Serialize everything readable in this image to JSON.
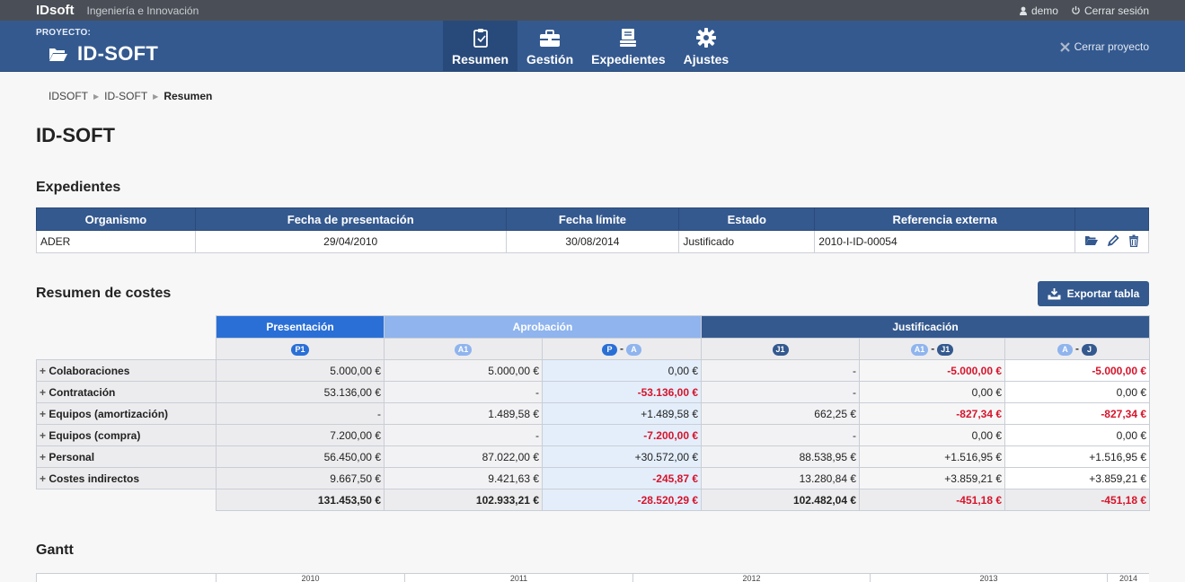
{
  "topbar": {
    "brand": "IDsoft",
    "tagline": "Ingeniería e Innovación",
    "user": "demo",
    "logout": "Cerrar sesión"
  },
  "header": {
    "project_label": "PROYECTO:",
    "project_name": "ID-SOFT",
    "close_project": "Cerrar proyecto",
    "nav": [
      {
        "label": "Resumen",
        "icon": "clipboard-icon",
        "active": true
      },
      {
        "label": "Gestión",
        "icon": "briefcase-icon",
        "active": false
      },
      {
        "label": "Expedientes",
        "icon": "file-stack-icon",
        "active": false
      },
      {
        "label": "Ajustes",
        "icon": "gear-icon",
        "active": false
      }
    ]
  },
  "breadcrumb": [
    "IDSOFT",
    "ID-SOFT",
    "Resumen"
  ],
  "page_title": "ID-SOFT",
  "expedientes": {
    "heading": "Expedientes",
    "columns": [
      "Organismo",
      "Fecha de presentación",
      "Fecha límite",
      "Estado",
      "Referencia externa"
    ],
    "rows": [
      {
        "organismo": "ADER",
        "fecha_presentacion": "29/04/2010",
        "fecha_limite": "30/08/2014",
        "estado": "Justificado",
        "referencia": "2010-I-ID-00054"
      }
    ]
  },
  "costes": {
    "heading": "Resumen de costes",
    "export_label": "Exportar tabla",
    "groups": [
      "Presentación",
      "Aprobación",
      "Justificación"
    ],
    "badges": {
      "p1": "P1",
      "a1": "A1",
      "p": "P",
      "a": "A",
      "j1": "J1",
      "j": "J",
      "dash": "-"
    },
    "rows": [
      {
        "name": "Colaboraciones",
        "p1": "5.000,00 €",
        "a1": "5.000,00 €",
        "pa": "0,00 €",
        "j1": "-",
        "a1j1": "-5.000,00 €",
        "aj": "-5.000,00 €"
      },
      {
        "name": "Contratación",
        "p1": "53.136,00 €",
        "a1": "-",
        "pa": "-53.136,00 €",
        "j1": "-",
        "a1j1": "0,00 €",
        "aj": "0,00 €"
      },
      {
        "name": "Equipos (amortización)",
        "p1": "-",
        "a1": "1.489,58 €",
        "pa": "+1.489,58 €",
        "j1": "662,25 €",
        "a1j1": "-827,34 €",
        "aj": "-827,34 €"
      },
      {
        "name": "Equipos (compra)",
        "p1": "7.200,00 €",
        "a1": "-",
        "pa": "-7.200,00 €",
        "j1": "-",
        "a1j1": "0,00 €",
        "aj": "0,00 €"
      },
      {
        "name": "Personal",
        "p1": "56.450,00 €",
        "a1": "87.022,00 €",
        "pa": "+30.572,00 €",
        "j1": "88.538,95 €",
        "a1j1": "+1.516,95 €",
        "aj": "+1.516,95 €"
      },
      {
        "name": "Costes indirectos",
        "p1": "9.667,50 €",
        "a1": "9.421,63 €",
        "pa": "-245,87 €",
        "j1": "13.280,84 €",
        "a1j1": "+3.859,21 €",
        "aj": "+3.859,21 €"
      }
    ],
    "total": {
      "p1": "131.453,50 €",
      "a1": "102.933,21 €",
      "pa": "-28.520,29 €",
      "j1": "102.482,04 €",
      "a1j1": "-451,18 €",
      "aj": "-451,18 €"
    }
  },
  "gantt": {
    "heading": "Gantt",
    "years": [
      "2010",
      "2011",
      "2012",
      "2013",
      "2014"
    ]
  },
  "colors": {
    "header_bg": "#34598f",
    "presentacion": "#2a6fd6",
    "aprobacion": "#8fb4ee",
    "justificacion": "#34598f",
    "negative": "#d6142b"
  }
}
